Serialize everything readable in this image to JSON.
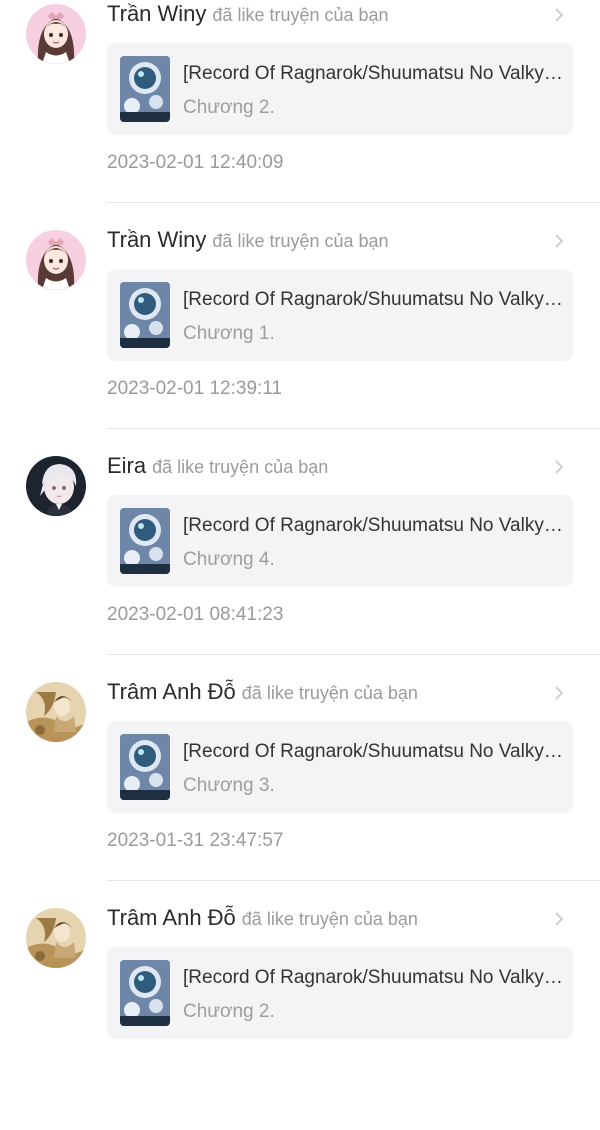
{
  "notifications": [
    {
      "username": "Trần Winy",
      "action": "đã like truyện của bạn",
      "avatar": "pink-girl-avatar",
      "story_title": "[Record Of Ragnarok/Shuumatsu No Valkyrie]",
      "chapter": "Chương 2.",
      "timestamp": "2023-02-01 12:40:09"
    },
    {
      "username": "Trần Winy",
      "action": "đã like truyện của bạn",
      "avatar": "pink-girl-avatar",
      "story_title": "[Record Of Ragnarok/Shuumatsu No Valkyrie]",
      "chapter": "Chương 1.",
      "timestamp": "2023-02-01 12:39:11"
    },
    {
      "username": "Eira",
      "action": "đã like truyện của bạn",
      "avatar": "white-hair-boy-avatar",
      "story_title": "[Record Of Ragnarok/Shuumatsu No Valkyrie]",
      "chapter": "Chương 4.",
      "timestamp": "2023-02-01 08:41:23"
    },
    {
      "username": "Trâm Anh Đỗ",
      "action": "đã like truyện của bạn",
      "avatar": "painting-avatar",
      "story_title": "[Record Of Ragnarok/Shuumatsu No Valkyrie]",
      "chapter": "Chương 3.",
      "timestamp": "2023-01-31 23:47:57"
    },
    {
      "username": "Trâm Anh Đỗ",
      "action": "đã like truyện của bạn",
      "avatar": "painting-avatar",
      "story_title": "[Record Of Ragnarok/Shuumatsu No Valkyrie]",
      "chapter": "Chương 2.",
      "timestamp": ""
    }
  ],
  "icons": {
    "chevron": "chevron-right-icon",
    "story_thumbnail": "story-cover-thumbnail"
  },
  "colors": {
    "card_background": "#f4f4f6",
    "username_text": "#2b2b2b",
    "secondary_text": "#9b9b9b"
  }
}
